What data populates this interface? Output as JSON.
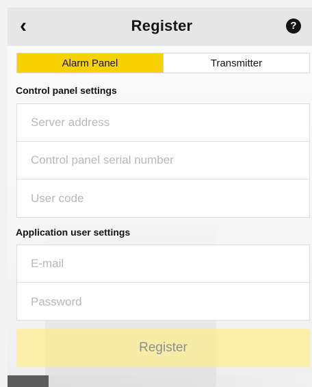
{
  "header": {
    "back_icon": "‹",
    "title": "Register",
    "help_icon": "?"
  },
  "tabs": [
    {
      "label": "Alarm Panel",
      "selected": true
    },
    {
      "label": "Transmitter",
      "selected": false
    }
  ],
  "sections": {
    "control_panel": {
      "title": "Control panel settings",
      "fields": [
        {
          "value": "",
          "placeholder": "Server address"
        },
        {
          "value": "",
          "placeholder": "Control panel serial number"
        },
        {
          "value": "",
          "placeholder": "User code"
        }
      ]
    },
    "application_user": {
      "title": "Application user settings",
      "fields": [
        {
          "value": "",
          "placeholder": "E-mail"
        },
        {
          "value": "",
          "placeholder": "Password"
        }
      ]
    }
  },
  "actions": {
    "register_label": "Register"
  },
  "colors": {
    "accent": "#f7d100",
    "button_disabled": "#fcee8f"
  },
  "icons": {
    "back": "back-icon",
    "help": "help-icon"
  }
}
